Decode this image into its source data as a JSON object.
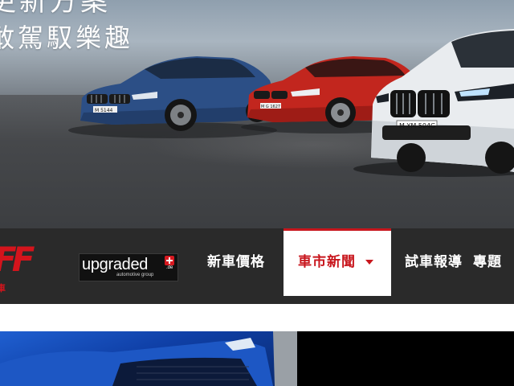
{
  "hero": {
    "line1": "更新方案",
    "line2": "敢駕馭樂趣",
    "plates": [
      "M 5144",
      "M G 1627",
      "M YM 504G"
    ]
  },
  "brand": {
    "logo_text": "FF",
    "logo_sub": "車"
  },
  "partner": {
    "word": "upgraded",
    "domain": ".de",
    "tagline": "automotive group"
  },
  "nav": {
    "items": [
      {
        "label": "新車價格",
        "active": false
      },
      {
        "label": "車市新聞",
        "active": true,
        "has_dropdown": true
      },
      {
        "label": "試車報導",
        "active": false
      },
      {
        "label": "專題",
        "active": false
      }
    ]
  },
  "colors": {
    "accent": "#c8161d",
    "navbar": "#2a2a2a"
  }
}
